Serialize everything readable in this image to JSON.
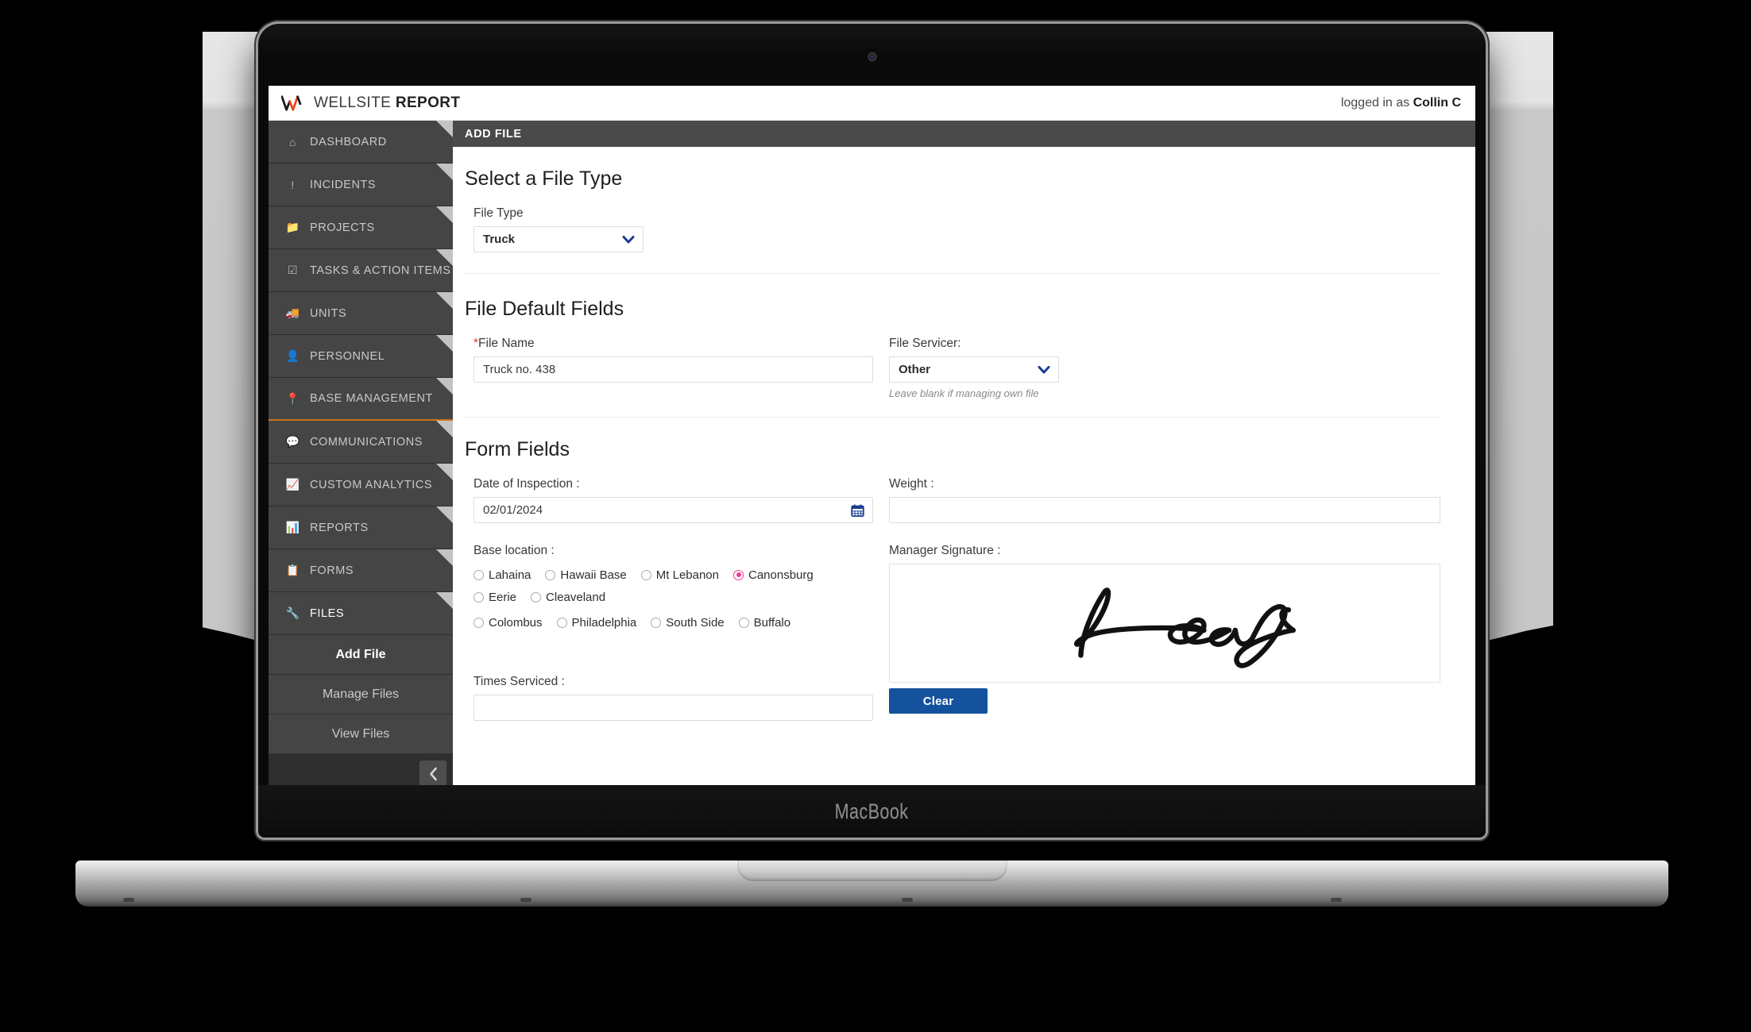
{
  "device": {
    "brand_wordmark": "MacBook"
  },
  "app": {
    "brand_name_light": "WELLSITE ",
    "brand_name_bold": "REPORT",
    "logo_icon": "wellsite-w-logo",
    "logged_in_prefix": "logged in as ",
    "logged_in_user": "Collin C",
    "page_title": "ADD FILE"
  },
  "sidebar": {
    "items": [
      {
        "label": "DASHBOARD",
        "icon": "home-icon",
        "active": false
      },
      {
        "label": "INCIDENTS",
        "icon": "exclamation-icon",
        "active": false
      },
      {
        "label": "PROJECTS",
        "icon": "folder-icon",
        "active": false
      },
      {
        "label": "TASKS & ACTION ITEMS",
        "icon": "checkbox-icon",
        "active": false
      },
      {
        "label": "UNITS",
        "icon": "truck-icon",
        "active": false
      },
      {
        "label": "PERSONNEL",
        "icon": "person-icon",
        "active": false
      },
      {
        "label": "BASE MANAGEMENT",
        "icon": "map-pin-icon",
        "active": false
      },
      {
        "label": "COMMUNICATIONS",
        "icon": "chat-icon",
        "active": false
      },
      {
        "label": "CUSTOM ANALYTICS",
        "icon": "line-chart-icon",
        "active": false
      },
      {
        "label": "REPORTS",
        "icon": "bar-chart-icon",
        "active": false
      },
      {
        "label": "FORMS",
        "icon": "clipboard-icon",
        "active": false
      },
      {
        "label": "FILES",
        "icon": "wrench-icon",
        "active": true
      }
    ],
    "subitems": [
      {
        "label": "Add File",
        "current": true
      },
      {
        "label": "Manage Files",
        "current": false
      },
      {
        "label": "View Files",
        "current": false
      }
    ],
    "collapse_icon": "chevron-left-icon",
    "divider_color": "#c8761f"
  },
  "main": {
    "section_file_type": {
      "heading": "Select a File Type",
      "file_type_label": "File Type",
      "file_type_value": "Truck"
    },
    "section_defaults": {
      "heading": "File Default Fields",
      "file_name_label": "File Name",
      "file_name_required_mark": "*",
      "file_name_value": "Truck no. 438",
      "file_servicer_label": "File Servicer:",
      "file_servicer_value": "Other",
      "file_servicer_hint": "Leave blank if managing own file"
    },
    "section_form_fields": {
      "heading": "Form Fields",
      "date_label": "Date of Inspection :",
      "date_value": "02/01/2024",
      "date_icon": "calendar-icon",
      "weight_label": "Weight :",
      "weight_value": "",
      "base_location_label": "Base location :",
      "base_locations": [
        {
          "label": "Lahaina",
          "selected": false
        },
        {
          "label": "Hawaii Base",
          "selected": false
        },
        {
          "label": "Mt Lebanon",
          "selected": false
        },
        {
          "label": "Canonsburg",
          "selected": true
        },
        {
          "label": "Eerie",
          "selected": false
        },
        {
          "label": "Cleaveland",
          "selected": false
        },
        {
          "label": "Colombus",
          "selected": false
        },
        {
          "label": "Philadelphia",
          "selected": false
        },
        {
          "label": "South Side",
          "selected": false
        },
        {
          "label": "Buffalo",
          "selected": false
        }
      ],
      "signature_label": "Manager Signature :",
      "signature_clear_label": "Clear",
      "times_serviced_label": "Times Serviced :",
      "times_serviced_value": ""
    }
  },
  "colors": {
    "accent_radio": "#ec3c96",
    "button_primary": "#14529e",
    "sidebar_bg": "#454545",
    "sidebar_divider_orange": "#c8761f",
    "logo_orange": "#e8451f",
    "dropdown_chevron": "#1a3f8f"
  }
}
